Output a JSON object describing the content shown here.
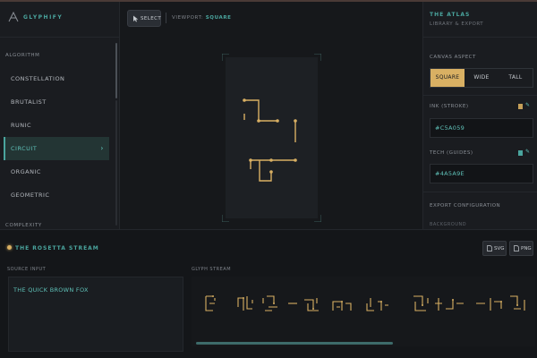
{
  "app": {
    "name": "GLYPHIFY"
  },
  "sidebar": {
    "section_label": "ALGORITHM",
    "items": [
      {
        "label": "CONSTELLATION"
      },
      {
        "label": "BRUTALIST"
      },
      {
        "label": "RUNIC"
      },
      {
        "label": "CIRCUIT"
      },
      {
        "label": "ORGANIC"
      },
      {
        "label": "GEOMETRIC"
      }
    ],
    "active_index": 3,
    "complexity_label": "COMPLEXITY"
  },
  "toolbar": {
    "select_label": "SELECT",
    "viewport_label": "VIEWPORT:",
    "viewport_value": "SQUARE"
  },
  "atlas": {
    "title": "THE ATLAS",
    "subtitle": "LIBRARY & EXPORT",
    "canvas_aspect_label": "CANVAS ASPECT",
    "aspect_options": [
      "SQUARE",
      "WIDE",
      "TALL"
    ],
    "aspect_selected": "SQUARE",
    "ink_label": "INK (STROKE)",
    "ink_value": "#C5A059",
    "tech_label": "TECH (GUIDES)",
    "tech_value": "#4A5A9E",
    "export_label": "EXPORT CONFIGURATION",
    "background_label": "BACKGROUND"
  },
  "stream": {
    "title": "THE ROSETTA STREAM",
    "svg_label": "SVG",
    "png_label": "PNG",
    "source_label": "SOURCE INPUT",
    "source_text": "THE QUICK BROWN FOX",
    "glyph_label": "GLYPH STREAM"
  },
  "colors": {
    "accent_teal": "#4aa59e",
    "ink_gold": "#d9b063",
    "ink_swatch": "#c5a059",
    "tech_swatch": "#4aa59e"
  }
}
